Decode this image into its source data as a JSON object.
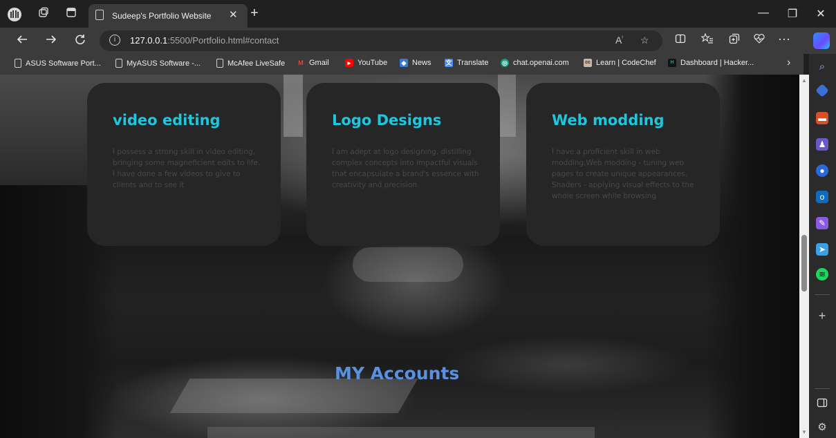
{
  "browser": {
    "tab_title": "Sudeep's Portfolio Website",
    "tab_close": "✕",
    "new_tab": "+",
    "url_host": "127.0.0.1",
    "url_path": ":5500/Portfolio.html#contact",
    "icons": {
      "profile": "profile-icon",
      "workspaces": "workspaces-icon",
      "tab_actions": "tab-actions-icon",
      "back": "back-icon",
      "forward": "forward-icon",
      "refresh": "refresh-icon",
      "info": "info-icon",
      "read_aloud": "read-aloud-icon",
      "favorite": "star-icon",
      "split_screen": "split-screen-icon",
      "favorites": "favorites-icon",
      "collections": "collections-icon",
      "browser_essentials": "heart-pulse-icon",
      "more": "more-icon",
      "copilot": "copilot-icon"
    },
    "window": {
      "minimize": "—",
      "restore": "❐",
      "close": "✕"
    }
  },
  "favorites": [
    {
      "label": "ASUS Software Port...",
      "icon": "page-icon"
    },
    {
      "label": "MyASUS Software -...",
      "icon": "page-icon"
    },
    {
      "label": "McAfee LiveSafe",
      "icon": "page-icon"
    },
    {
      "label": "Gmail",
      "icon": "gmail-icon",
      "color": "#ea4335"
    },
    {
      "label": "YouTube",
      "icon": "youtube-icon",
      "color": "#ff0000"
    },
    {
      "label": "News",
      "icon": "news-icon",
      "color": "#3a78d8"
    },
    {
      "label": "Translate",
      "icon": "translate-icon",
      "color": "#4a8af4"
    },
    {
      "label": "chat.openai.com",
      "icon": "openai-icon",
      "color": "#10a37f"
    },
    {
      "label": "Learn | CodeChef",
      "icon": "codechef-icon",
      "color": "#5b4638"
    },
    {
      "label": "Dashboard | Hacker...",
      "icon": "hackerrank-icon",
      "color": "#1ba94c"
    }
  ],
  "favorites_more": "›",
  "page": {
    "cards": [
      {
        "title": "video editing",
        "text": "I possess a strong skill in video editing, bringing some magneficient edits to life. I have done a few videos to give to clients and to see it"
      },
      {
        "title": "Logo Designs",
        "text": "I am adept at logo designing, distilling complex concepts into impactful visuals that encapsulate a brand's essence with creativity and precision."
      },
      {
        "title": "Web modding",
        "text": "I have a proficient skill in web modding,Web modding - tuning web pages to create unique appearances. Shaders - applying visual effects to the whole screen while browsing"
      }
    ],
    "accounts_heading": "MY Accounts"
  },
  "sidebar": {
    "icons": [
      "search-icon",
      "tag-icon",
      "toolbox-icon",
      "games-icon",
      "copilot-circle-icon",
      "outlook-icon",
      "designer-icon",
      "send-icon",
      "spotify-icon",
      "add-icon",
      "sidebar-toggle-icon",
      "settings-icon"
    ]
  },
  "colors": {
    "card_title": "#1cc8e0",
    "accounts_heading": "#5b8fe0",
    "card_bg": "#262626"
  }
}
